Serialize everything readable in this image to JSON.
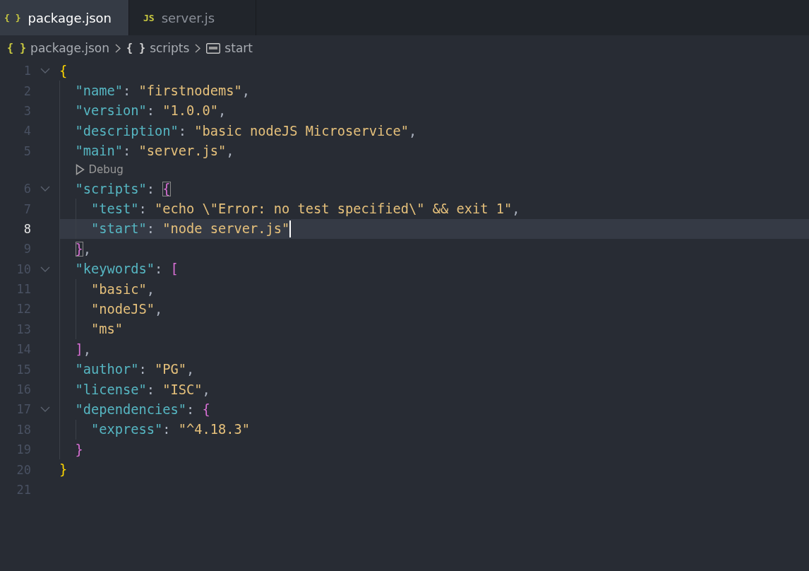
{
  "tabs": [
    {
      "icon": "{ }",
      "label": "package.json",
      "selected": true
    },
    {
      "icon": "JS",
      "label": "server.js",
      "selected": false
    }
  ],
  "breadcrumb": [
    {
      "kind": "file",
      "icon": "{ }",
      "label": "package.json"
    },
    {
      "kind": "object",
      "icon": "{ }",
      "label": "scripts"
    },
    {
      "kind": "string",
      "label": "start"
    }
  ],
  "lines": [
    {
      "kind": "code",
      "number": "1",
      "current": false,
      "tokens": [
        {
          "kind": "brace1",
          "text": "{"
        }
      ],
      "children": [
        {
          "kind": "code",
          "number": "2",
          "current": false,
          "tokens": [
            {
              "kind": "key",
              "text": "\"name\""
            },
            {
              "kind": "punct",
              "text": ": "
            },
            {
              "kind": "str",
              "text": "\"firstnodems\""
            },
            {
              "kind": "punct",
              "text": ","
            }
          ]
        },
        {
          "kind": "code",
          "number": "3",
          "current": false,
          "tokens": [
            {
              "kind": "key",
              "text": "\"version\""
            },
            {
              "kind": "punct",
              "text": ": "
            },
            {
              "kind": "str",
              "text": "\"1.0.0\""
            },
            {
              "kind": "punct",
              "text": ","
            }
          ]
        },
        {
          "kind": "code",
          "number": "4",
          "current": false,
          "tokens": [
            {
              "kind": "key",
              "text": "\"description\""
            },
            {
              "kind": "punct",
              "text": ": "
            },
            {
              "kind": "str",
              "text": "\"basic nodeJS Microservice\""
            },
            {
              "kind": "punct",
              "text": ","
            }
          ]
        },
        {
          "kind": "code",
          "number": "5",
          "current": false,
          "tokens": [
            {
              "kind": "key",
              "text": "\"main\""
            },
            {
              "kind": "punct",
              "text": ": "
            },
            {
              "kind": "str",
              "text": "\"server.js\""
            },
            {
              "kind": "punct",
              "text": ","
            }
          ]
        },
        {
          "kind": "codelens",
          "label": "Debug"
        },
        {
          "kind": "code",
          "number": "6",
          "current": false,
          "tokens": [
            {
              "kind": "key",
              "text": "\"scripts\""
            },
            {
              "kind": "punct",
              "text": ": "
            },
            {
              "kind": "brace2",
              "text": "{",
              "matched": true
            }
          ],
          "children": [
            {
              "kind": "code",
              "number": "7",
              "current": false,
              "tokens": [
                {
                  "kind": "key",
                  "text": "\"test\""
                },
                {
                  "kind": "punct",
                  "text": ": "
                },
                {
                  "kind": "str",
                  "text": "\"echo \\\"Error: no test specified\\\" && exit 1\""
                },
                {
                  "kind": "punct",
                  "text": ","
                }
              ]
            },
            {
              "kind": "code",
              "number": "8",
              "current": true,
              "tokens": [
                {
                  "kind": "key",
                  "text": "\"start\""
                },
                {
                  "kind": "punct",
                  "text": ": "
                },
                {
                  "kind": "str",
                  "text": "\"node server.js\""
                }
              ]
            }
          ]
        },
        {
          "kind": "code",
          "number": "9",
          "current": false,
          "tokens": [
            {
              "kind": "brace2",
              "text": "}",
              "matched": true
            },
            {
              "kind": "punct",
              "text": ","
            }
          ]
        },
        {
          "kind": "code",
          "number": "10",
          "current": false,
          "tokens": [
            {
              "kind": "key",
              "text": "\"keywords\""
            },
            {
              "kind": "punct",
              "text": ": "
            },
            {
              "kind": "brace2",
              "text": "[",
              "matched": false
            }
          ],
          "children": [
            {
              "kind": "code",
              "number": "11",
              "current": false,
              "tokens": [
                {
                  "kind": "str",
                  "text": "\"basic\""
                },
                {
                  "kind": "punct",
                  "text": ","
                }
              ]
            },
            {
              "kind": "code",
              "number": "12",
              "current": false,
              "tokens": [
                {
                  "kind": "str",
                  "text": "\"nodeJS\""
                },
                {
                  "kind": "punct",
                  "text": ","
                }
              ]
            },
            {
              "kind": "code",
              "number": "13",
              "current": false,
              "tokens": [
                {
                  "kind": "str",
                  "text": "\"ms\""
                }
              ]
            }
          ]
        },
        {
          "kind": "code",
          "number": "14",
          "current": false,
          "tokens": [
            {
              "kind": "brace2",
              "text": "]",
              "matched": false
            },
            {
              "kind": "punct",
              "text": ","
            }
          ]
        },
        {
          "kind": "code",
          "number": "15",
          "current": false,
          "tokens": [
            {
              "kind": "key",
              "text": "\"author\""
            },
            {
              "kind": "punct",
              "text": ": "
            },
            {
              "kind": "str",
              "text": "\"PG\""
            },
            {
              "kind": "punct",
              "text": ","
            }
          ]
        },
        {
          "kind": "code",
          "number": "16",
          "current": false,
          "tokens": [
            {
              "kind": "key",
              "text": "\"license\""
            },
            {
              "kind": "punct",
              "text": ": "
            },
            {
              "kind": "str",
              "text": "\"ISC\""
            },
            {
              "kind": "punct",
              "text": ","
            }
          ]
        },
        {
          "kind": "code",
          "number": "17",
          "current": false,
          "tokens": [
            {
              "kind": "key",
              "text": "\"dependencies\""
            },
            {
              "kind": "punct",
              "text": ": "
            },
            {
              "kind": "brace2",
              "text": "{",
              "matched": false
            }
          ],
          "children": [
            {
              "kind": "code",
              "number": "18",
              "current": false,
              "tokens": [
                {
                  "kind": "key",
                  "text": "\"express\""
                },
                {
                  "kind": "punct",
                  "text": ": "
                },
                {
                  "kind": "str",
                  "text": "\"^4.18.3\""
                }
              ]
            }
          ]
        },
        {
          "kind": "code",
          "number": "19",
          "current": false,
          "tokens": [
            {
              "kind": "brace2",
              "text": "}",
              "matched": false
            }
          ]
        }
      ]
    },
    {
      "kind": "code",
      "number": "20",
      "current": false,
      "tokens": [
        {
          "kind": "brace1",
          "text": "}"
        }
      ]
    },
    {
      "kind": "code",
      "number": "21",
      "current": false
    }
  ]
}
